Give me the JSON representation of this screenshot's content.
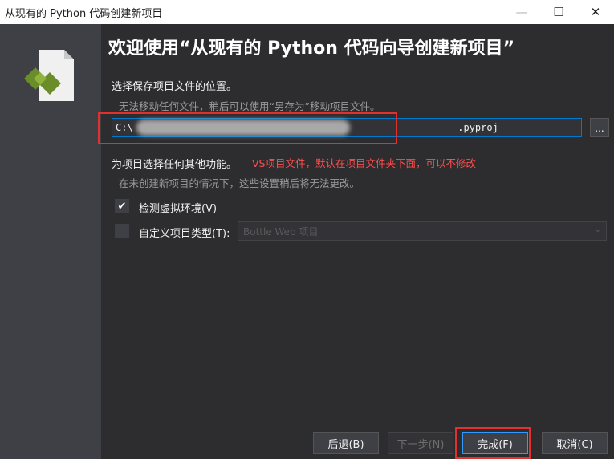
{
  "window": {
    "title": "从现有的 Python 代码创建新项目",
    "minimize": "—",
    "maximize": "☐",
    "close": "✕"
  },
  "heading": "欢迎使用“从现有的 Python 代码向导创建新项目”",
  "location": {
    "label": "选择保存项目文件的位置。",
    "hint": "无法移动任何文件，稍后可以使用“另存为”移动项目文件。",
    "path_value": "C:\\                                                        .pyproj",
    "browse_label": "..."
  },
  "features": {
    "label": "为项目选择任何其他功能。",
    "annotation": "VS项目文件，默认在项目文件夹下面，可以不修改",
    "hint": "在未创建新项目的情况下，这些设置稍后将无法更改。",
    "detect_env": {
      "label": "检测虚拟环境(V)",
      "checked": true,
      "check_glyph": "✔"
    },
    "custom_type": {
      "label": "自定义项目类型(T):",
      "checked": false,
      "placeholder": "Bottle Web 项目",
      "chevron": "⌄"
    }
  },
  "buttons": {
    "back": "后退(B)",
    "next": "下一步(N)",
    "finish": "完成(F)",
    "cancel": "取消(C)"
  },
  "colors": {
    "accent": "#007acc",
    "highlight": "#e03030",
    "annotation": "#ff4d4d",
    "logo_green": "#6a8c2a"
  }
}
